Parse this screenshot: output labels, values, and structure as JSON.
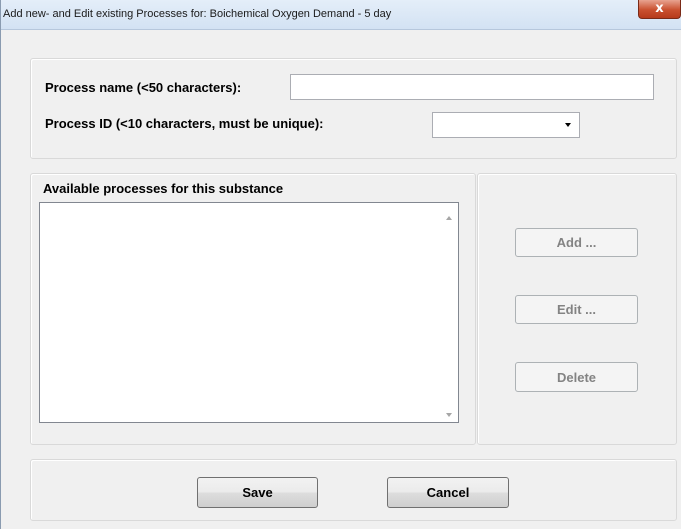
{
  "window": {
    "title": "Add new- and Edit existing Processes for: Boichemical Oxygen Demand - 5 day",
    "close_glyph": "x",
    "close_icon": "close-icon"
  },
  "form": {
    "process_name_label": "Process name (<50 characters):",
    "process_name_value": "",
    "process_id_label": "Process ID (<10 characters, must be unique):",
    "process_id_value": "",
    "process_id_icon": "chevron-down-icon"
  },
  "list": {
    "label": "Available processes for this substance",
    "items": [],
    "scroll_up_icon": "scroll-up-arrow-icon",
    "scroll_down_icon": "scroll-down-arrow-icon"
  },
  "actions": {
    "add_label": "Add ...",
    "edit_label": "Edit ...",
    "delete_label": "Delete"
  },
  "footer": {
    "save_label": "Save",
    "cancel_label": "Cancel"
  }
}
